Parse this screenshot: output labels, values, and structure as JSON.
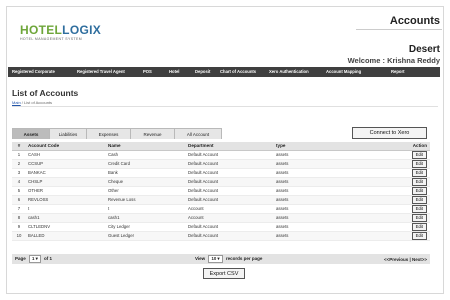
{
  "logo": {
    "brand_a": "HOTEL",
    "brand_b": "OGIX",
    "brand_x": "X",
    "tagline": "HOTEL MANAGEMENT SYSTEM"
  },
  "header": {
    "title": "Accounts",
    "property": "Desert",
    "welcome": "Welcome : Krishna Reddy"
  },
  "nav": [
    {
      "label": "Registered Corporate"
    },
    {
      "label": "Registered Travel Agent"
    },
    {
      "label": "POS"
    },
    {
      "label": "Hotel"
    },
    {
      "label": "Deposit"
    },
    {
      "label": "Chart of Accounts"
    },
    {
      "label": "Xero Authentication"
    },
    {
      "label": "Account Mapping"
    },
    {
      "label": "Report"
    }
  ],
  "page": {
    "title": "List of Accounts",
    "breadcrumb_home": "Main",
    "breadcrumb_sep": " / ",
    "breadcrumb_current": "List of Accounts"
  },
  "tabs": [
    {
      "label": "Assets",
      "active": true
    },
    {
      "label": "Liabilities"
    },
    {
      "label": "Expenses"
    },
    {
      "label": "Revenue"
    },
    {
      "label": "All Account"
    }
  ],
  "connect_label": "Connect to Xero",
  "table": {
    "headers": [
      "#",
      "Account Code",
      "Name",
      "Department",
      "type",
      "Action"
    ],
    "rows": [
      [
        "1",
        "CASH",
        "Cash",
        "Default Account",
        "assets"
      ],
      [
        "2",
        "CCSUP",
        "Credit Card",
        "Default Account",
        "assets"
      ],
      [
        "3",
        "BANKAC",
        "Bank",
        "Default Account",
        "assets"
      ],
      [
        "4",
        "CHSLP",
        "Cheque",
        "Default Account",
        "assets"
      ],
      [
        "5",
        "OTHER",
        "Other",
        "Default Account",
        "assets"
      ],
      [
        "6",
        "REVLOSS",
        "Revenue Loss",
        "Default Account",
        "assets"
      ],
      [
        "7",
        "t",
        "t",
        "Account",
        "assets"
      ],
      [
        "8",
        "cash1",
        "cash1",
        "Account",
        "assets"
      ],
      [
        "9",
        "CLTLEDNV",
        "City Ledger",
        "Default Account",
        "assets"
      ],
      [
        "10",
        "BALLED",
        "Guest Ledger",
        "Default Account",
        "assets"
      ]
    ],
    "edit_label": "Edit"
  },
  "pager": {
    "page_label": "Page",
    "page_value": "1 ▾",
    "of_label": "of 1",
    "view_label": "View",
    "view_value": "10 ▾",
    "records_label": "records per page",
    "prev": "<<Previous",
    "sep": " | ",
    "next": "Next>>"
  },
  "export_label": "Export CSV"
}
